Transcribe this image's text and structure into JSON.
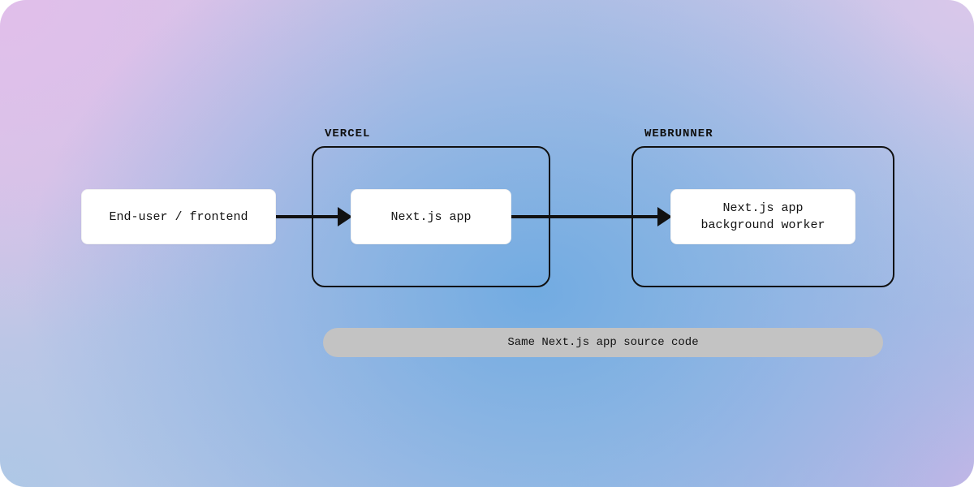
{
  "nodes": {
    "end_user": "End-user / frontend",
    "nextjs_app": "Next.js app",
    "background_worker": "Next.js app\nbackground worker"
  },
  "groups": {
    "vercel_label": "VERCEL",
    "webrunner_label": "WEBRUNNER"
  },
  "caption": "Same Next.js app source code"
}
